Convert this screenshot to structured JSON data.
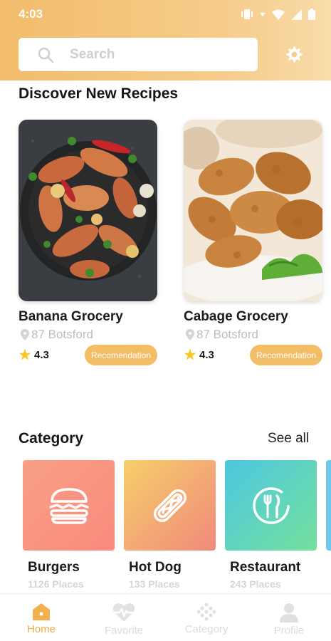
{
  "status_bar": {
    "time": "4:03"
  },
  "search": {
    "placeholder": "Search",
    "icon": "search-icon"
  },
  "header": {
    "settings_icon": "gear-icon"
  },
  "discover": {
    "title": "Discover New Recipes",
    "recipes": [
      {
        "name": "Banana Grocery",
        "location": "87 Botsford",
        "rating": "4.3",
        "button": "Recomendation",
        "image": "grilled-chicken-wings-photo"
      },
      {
        "name": "Cabage Grocery",
        "location": "87 Botsford",
        "rating": "4.3",
        "button": "Recomendation",
        "image": "fried-chicken-photo"
      }
    ]
  },
  "category": {
    "title": "Category",
    "see_all": "See all",
    "items": [
      {
        "name": "Burgers",
        "places": "1126 Places",
        "icon": "burger-icon",
        "colors": [
          "#f99c86",
          "#f9897d"
        ]
      },
      {
        "name": "Hot Dog",
        "places": "133 Places",
        "icon": "hotdog-icon",
        "colors": [
          "#f6cd6a",
          "#f1897c"
        ]
      },
      {
        "name": "Restaurant",
        "places": "243 Places",
        "icon": "restaurant-icon",
        "colors": [
          "#4ec8df",
          "#71df9f"
        ]
      }
    ]
  },
  "bottom_nav": {
    "items": [
      {
        "label": "Home",
        "icon": "home-icon",
        "active": true
      },
      {
        "label": "Favorite",
        "icon": "heart-pulse-icon",
        "active": false
      },
      {
        "label": "Category",
        "icon": "grid-dots-icon",
        "active": false
      },
      {
        "label": "Profile",
        "icon": "person-icon",
        "active": false
      }
    ]
  },
  "colors": {
    "accent": "#f3bd66",
    "active_nav": "#eeac45",
    "muted": "#dcdcdc"
  }
}
